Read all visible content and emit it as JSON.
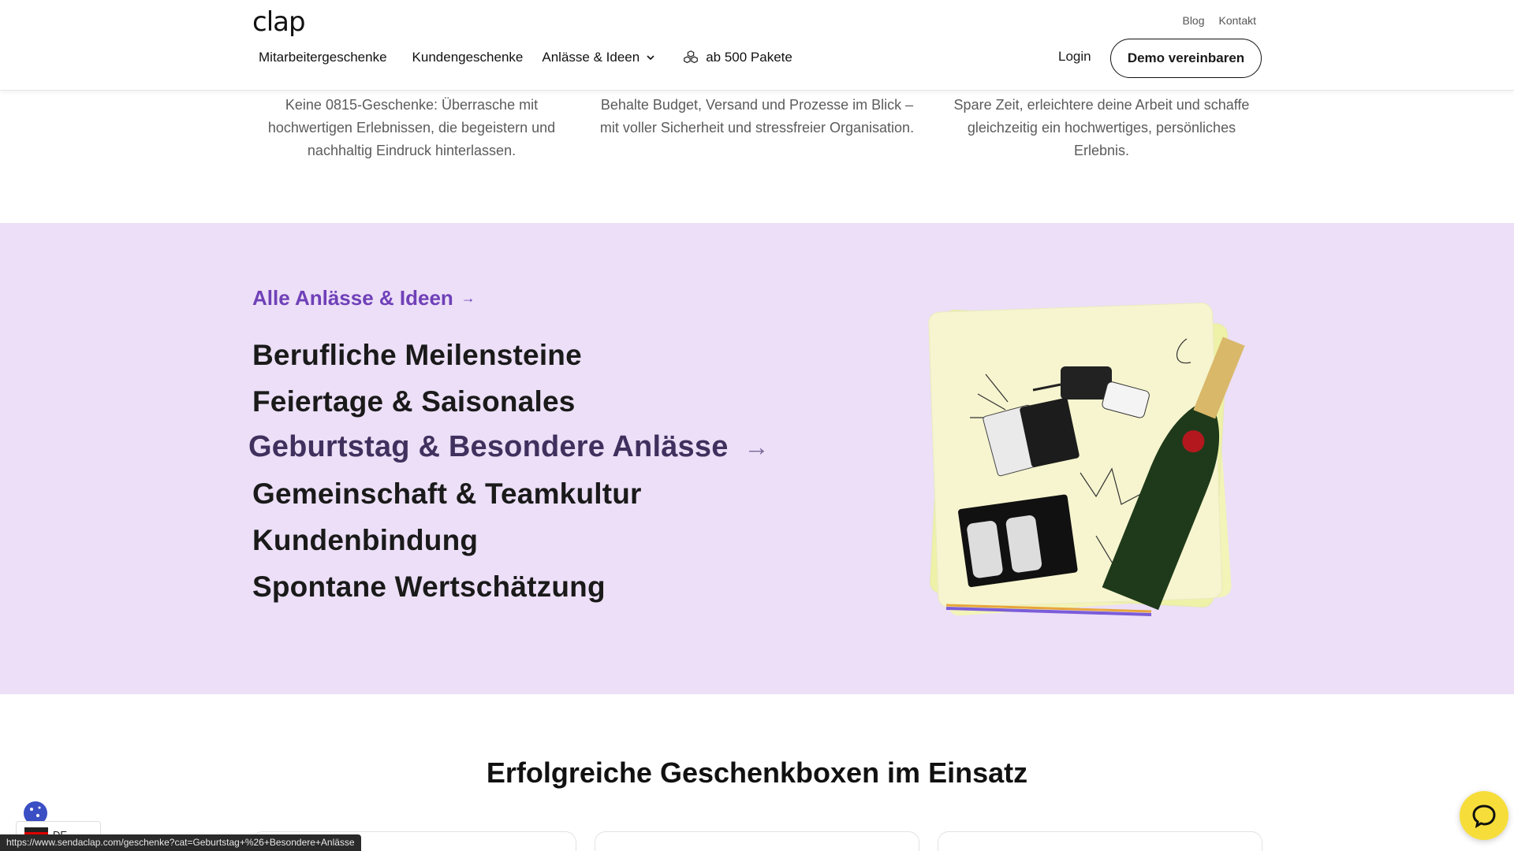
{
  "header": {
    "logo": "clap",
    "toplinks": [
      "Blog",
      "Kontakt"
    ],
    "nav": [
      {
        "label": "Mitarbeitergeschenke"
      },
      {
        "label": "Kundengeschenke"
      },
      {
        "label": "Anlässe & Ideen"
      },
      {
        "label": "ab 500 Pakete"
      }
    ],
    "login": "Login",
    "demo": "Demo vereinbaren"
  },
  "features": [
    "Keine 0815-Geschenke: Überrasche mit hochwertigen Erlebnissen, die begeistern und nachhaltig Eindruck hinterlassen.",
    "Behalte Budget, Versand und Prozesse im Blick – mit voller Sicherheit und stressfreier Organisation.",
    "Spare Zeit, erleichtere deine Arbeit und schaffe gleichzeitig ein hochwertiges, persönliches Erlebnis."
  ],
  "occasions": {
    "all_link": "Alle Anlässe & Ideen",
    "items": [
      "Berufliche Meilensteine",
      "Feiertage & Saisonales",
      "Geburtstag & Besondere Anlässe",
      "Gemeinschaft & Teamkultur",
      "Kundenbindung",
      "Spontane Wertschätzung"
    ],
    "active_index": 2
  },
  "bottom": {
    "title": "Erfolgreiche Geschenkboxen im Einsatz"
  },
  "floating": {
    "lang": "DE",
    "status_url": "https://www.sendaclap.com/geschenke?cat=Geburtstag+%26+Besondere+Anlässe"
  },
  "colors": {
    "section_bg": "#ecdff7",
    "accent_purple": "#7040b8",
    "chat_yellow": "#f7dd39"
  }
}
